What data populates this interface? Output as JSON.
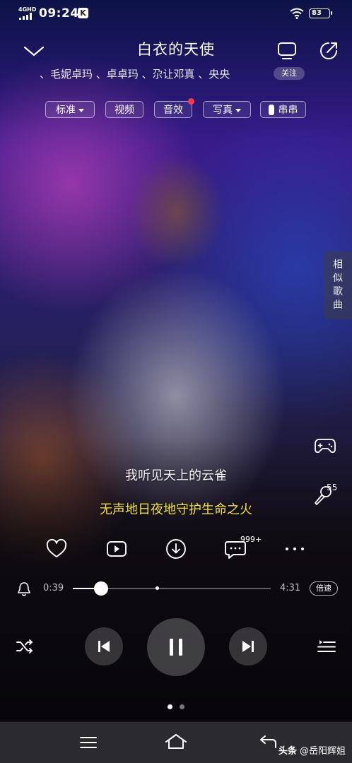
{
  "status_bar": {
    "network": "4GHD",
    "time": "09:24",
    "app_badge": "K",
    "battery": "83"
  },
  "song": {
    "title": "白衣的天使",
    "artists": "、毛妮卓玛 、卓卓玛 、尕让邓真 、央央",
    "follow_label": "关注"
  },
  "chips": {
    "standard": "标准",
    "video": "视频",
    "sound_effect": "音效",
    "photo": "写真",
    "chuanchuan": "串串"
  },
  "similar_songs": "相似歌曲",
  "lyrics": {
    "line1": "我听见天上的云雀",
    "line2": "无声地日夜地守护生命之火"
  },
  "singing_count": "55",
  "comment_count": "999+",
  "progress": {
    "current": "0:39",
    "total": "4:31",
    "fraction": 0.144,
    "speed_label": "倍速"
  },
  "pager": {
    "total": 2,
    "active": 0
  },
  "watermark": {
    "brand": "头条",
    "handle": "@岳阳辉姐"
  },
  "colors": {
    "current_lyric": "#f2e23a",
    "notification_dot": "#ff3b4a",
    "nav_bar": "#2b2b2f"
  }
}
